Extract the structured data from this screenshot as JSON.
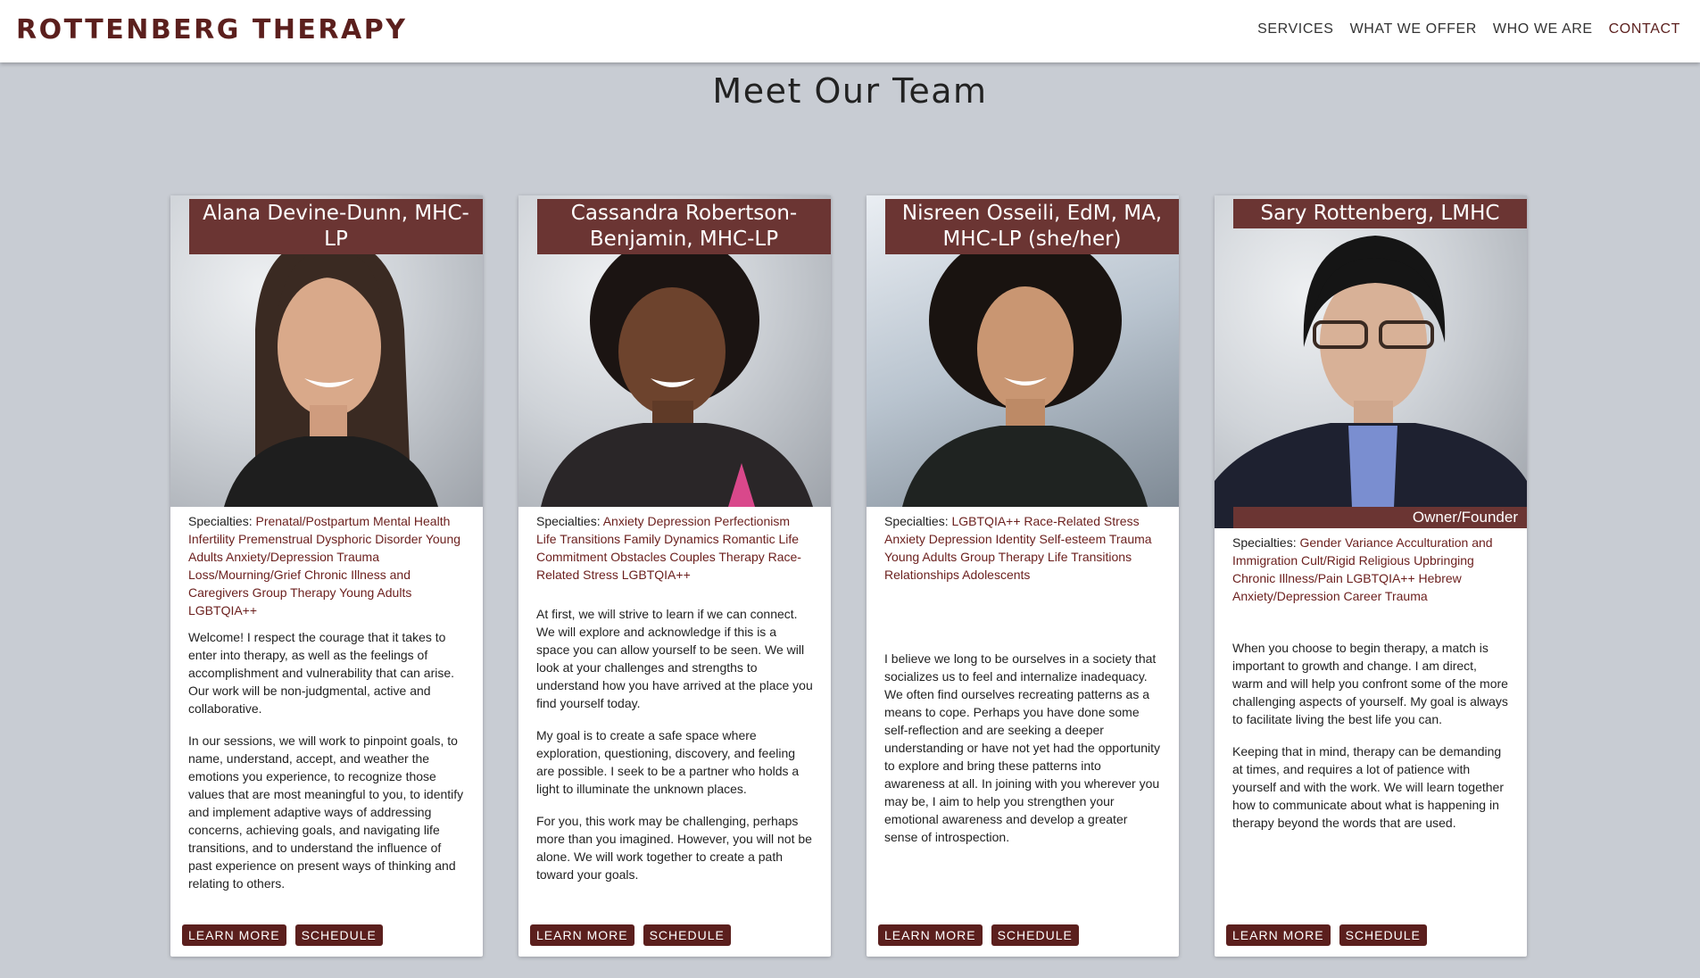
{
  "header": {
    "brand": "ROTTENBERG THERAPY",
    "nav": [
      "SERVICES",
      "WHAT WE OFFER",
      "WHO WE ARE",
      "CONTACT"
    ],
    "active_nav": "CONTACT"
  },
  "page": {
    "title": "Meet Our Team"
  },
  "colors": {
    "accent": "#5b1f1d",
    "name_bar": "#6b3533",
    "background": "#c8ccd3"
  },
  "team": [
    {
      "name": "Alana Devine-Dunn, MHC-LP",
      "specialties_label": "Specialties:",
      "specialties": "Prenatal/Postpartum Mental Health Infertility Premenstrual Dysphoric Disorder Young Adults Anxiety/Depression Trauma Loss/Mourning/Grief Chronic Illness and Caregivers Group Therapy Young Adults LGBTQIA++",
      "bio": [
        "Welcome! I respect the courage that it takes to enter into therapy, as well as the feelings of accomplishment and vulnerability that can arise. Our work will be non-judgmental, active and collaborative.",
        "In our sessions, we will work to pinpoint goals, to name, understand, accept, and weather the emotions you experience, to recognize those values that are most meaningful to you, to identify and implement adaptive ways of addressing concerns, achieving goals, and navigating life transitions, and to understand the influence of past experience on present ways of thinking and relating to others."
      ],
      "learn_more": "LEARN MORE",
      "schedule": "SCHEDULE"
    },
    {
      "name": "Cassandra Robertson-Benjamin, MHC-LP",
      "specialties_label": "Specialties:",
      "specialties": "Anxiety Depression Perfectionism Life Transitions Family Dynamics Romantic Life Commitment Obstacles Couples Therapy Race-Related Stress LGBTQIA++",
      "bio": [
        "At first, we will strive to learn if we can connect. We will explore and acknowledge if this is a space you can allow yourself to be seen. We will look at your challenges and strengths to understand how you have arrived at the place you find yourself today.",
        "My goal is to create a safe space where exploration, questioning, discovery, and feeling are possible. I seek to be a partner who holds a light to illuminate the unknown places.",
        "For you, this work may be challenging, perhaps more than you imagined. However, you will not be alone. We will work together to create a path toward your goals."
      ],
      "learn_more": "LEARN MORE",
      "schedule": "SCHEDULE"
    },
    {
      "name": "Nisreen Osseili, EdM, MA, MHC-LP (she/her)",
      "specialties_label": "Specialties:",
      "specialties": "LGBTQIA++ Race-Related Stress Anxiety Depression Identity Self-esteem Trauma Young Adults Group Therapy Life Transitions Relationships Adolescents",
      "bio": [
        "I believe we long to be ourselves in a society that socializes us to feel and internalize inadequacy. We often find ourselves recreating patterns as a means to cope. Perhaps you have done some self-reflection and are seeking a deeper understanding or have not yet had the opportunity to explore and bring these patterns into awareness at all. In joining with you wherever you may be, I aim to help you strengthen your emotional awareness and develop a greater sense of introspection."
      ],
      "learn_more": "LEARN MORE",
      "schedule": "SCHEDULE"
    },
    {
      "name": "Sary Rottenberg, LMHC",
      "role": "Owner/Founder",
      "specialties_label": "Specialties:",
      "specialties": "Gender Variance Acculturation and Immigration Cult/Rigid Religious Upbringing Chronic Illness/Pain LGBTQIA++ Hebrew Anxiety/Depression Career Trauma",
      "bio": [
        "When you choose to begin therapy, a match is important to growth and change. I am direct, warm and will help you confront some of the more challenging aspects of yourself. My goal is always to facilitate living the best life you can.",
        "Keeping that in mind, therapy can be demanding at times, and requires a lot of patience with yourself and with the work. We will learn together how to communicate about what is happening in therapy beyond the words that are used."
      ],
      "learn_more": "LEARN MORE",
      "schedule": "SCHEDULE"
    }
  ]
}
